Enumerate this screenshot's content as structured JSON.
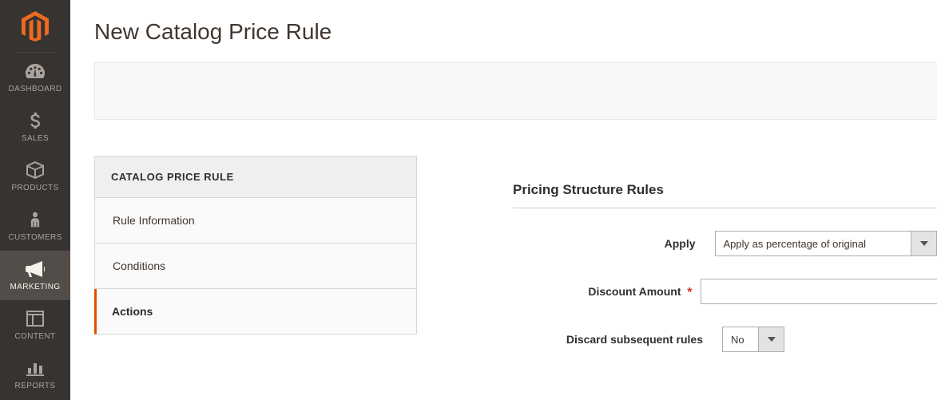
{
  "nav": {
    "items": [
      {
        "id": "dashboard",
        "label": "DASHBOARD"
      },
      {
        "id": "sales",
        "label": "SALES"
      },
      {
        "id": "products",
        "label": "PRODUCTS"
      },
      {
        "id": "customers",
        "label": "CUSTOMERS"
      },
      {
        "id": "marketing",
        "label": "MARKETING",
        "active": true
      },
      {
        "id": "content",
        "label": "CONTENT"
      },
      {
        "id": "reports",
        "label": "REPORTS"
      }
    ]
  },
  "page": {
    "title": "New Catalog Price Rule"
  },
  "tabs": {
    "heading": "CATALOG PRICE RULE",
    "items": [
      {
        "id": "rule-info",
        "label": "Rule Information"
      },
      {
        "id": "conditions",
        "label": "Conditions"
      },
      {
        "id": "actions",
        "label": "Actions",
        "active": true
      }
    ]
  },
  "form": {
    "legend": "Pricing Structure Rules",
    "fields": {
      "apply": {
        "label": "Apply",
        "value": "Apply as percentage of original"
      },
      "amount": {
        "label": "Discount Amount",
        "value": "",
        "required": true
      },
      "discard": {
        "label": "Discard subsequent rules",
        "value": "No"
      }
    }
  }
}
